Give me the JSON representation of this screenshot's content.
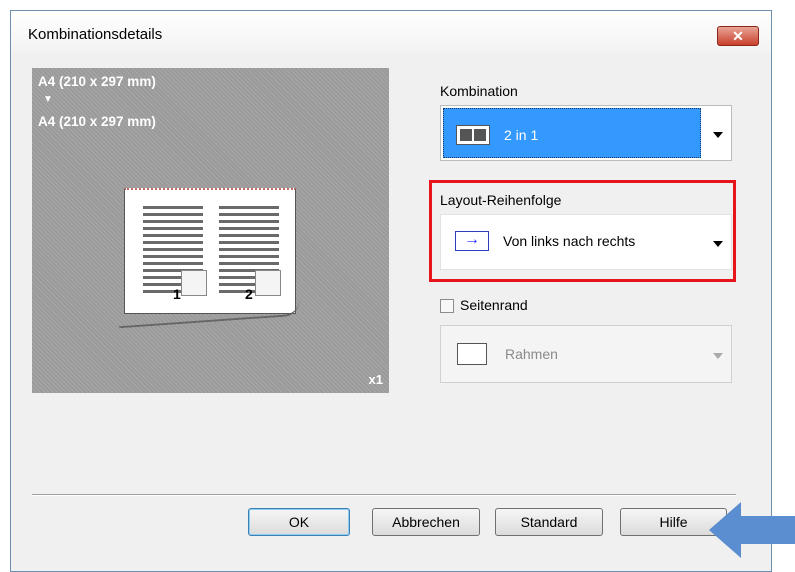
{
  "window": {
    "title": "Kombinationsdetails",
    "close_glyph": "✕"
  },
  "preview": {
    "source_size": "A4 (210 x 297 mm)",
    "arrow": "▼",
    "target_size": "A4 (210 x 297 mm)",
    "page_labels": [
      "1",
      "2"
    ],
    "copies": "x1"
  },
  "combination": {
    "label": "Kombination",
    "value": "2 in 1",
    "icon": "two-pages-icon"
  },
  "layout_order": {
    "label": "Layout-Reihenfolge",
    "value": "Von links nach rechts",
    "icon": "arrow-right-icon",
    "icon_glyph": "→"
  },
  "border": {
    "label": "Seitenrand",
    "checked": false,
    "value": "Rahmen",
    "icon": "frame-icon"
  },
  "buttons": {
    "ok": "OK",
    "cancel": "Abbrechen",
    "standard": "Standard",
    "help": "Hilfe"
  },
  "colors": {
    "selection": "#3399ff",
    "highlight": "#e8141b",
    "arrow": "#5b8ed0"
  }
}
